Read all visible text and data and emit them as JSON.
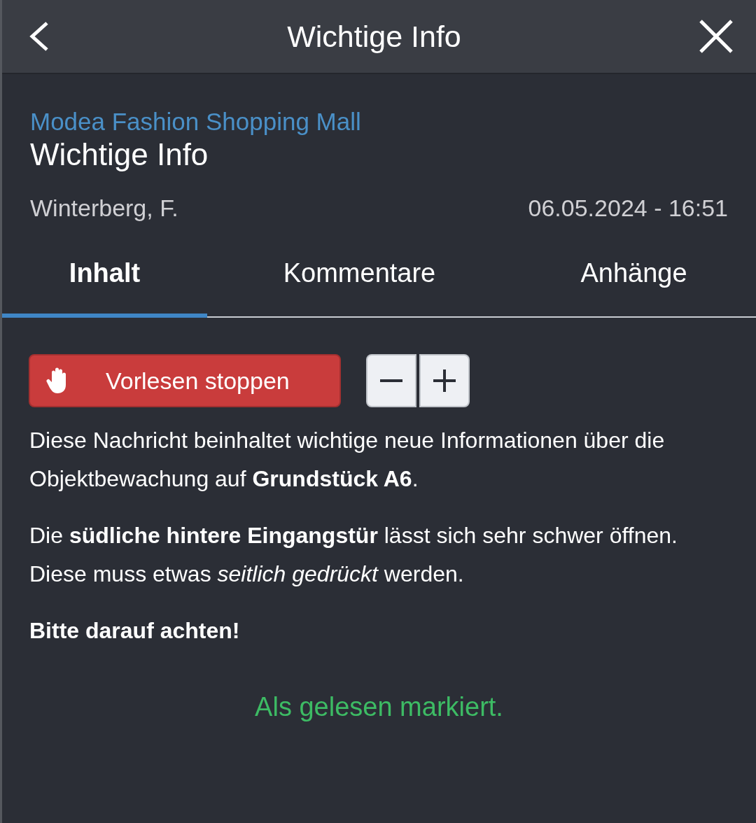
{
  "header": {
    "title": "Wichtige Info"
  },
  "message": {
    "source": "Modea Fashion Shopping Mall",
    "title": "Wichtige Info",
    "author": "Winterberg, F.",
    "timestamp": "06.05.2024 - 16:51"
  },
  "tabs": [
    {
      "label": "Inhalt",
      "selected": true
    },
    {
      "label": "Kommentare",
      "selected": false
    },
    {
      "label": "Anhänge",
      "selected": false
    }
  ],
  "read_aloud_button": {
    "label": "Vorlesen stoppen"
  },
  "paragraphs": [
    {
      "kind": "text",
      "text": "Diese Nachricht beinhaltet wichtige neue Informationen über die Objektbewachung auf **Grundstück A6**."
    },
    {
      "kind": "text",
      "text": "Die **südliche hintere Eingangstür** lässt sich sehr schwer öffnen. Diese muss etwas *seitlich gedrückt* werden."
    },
    {
      "kind": "emphasis",
      "text": "Bitte darauf achten!"
    }
  ],
  "status": "Als gelesen markiert."
}
